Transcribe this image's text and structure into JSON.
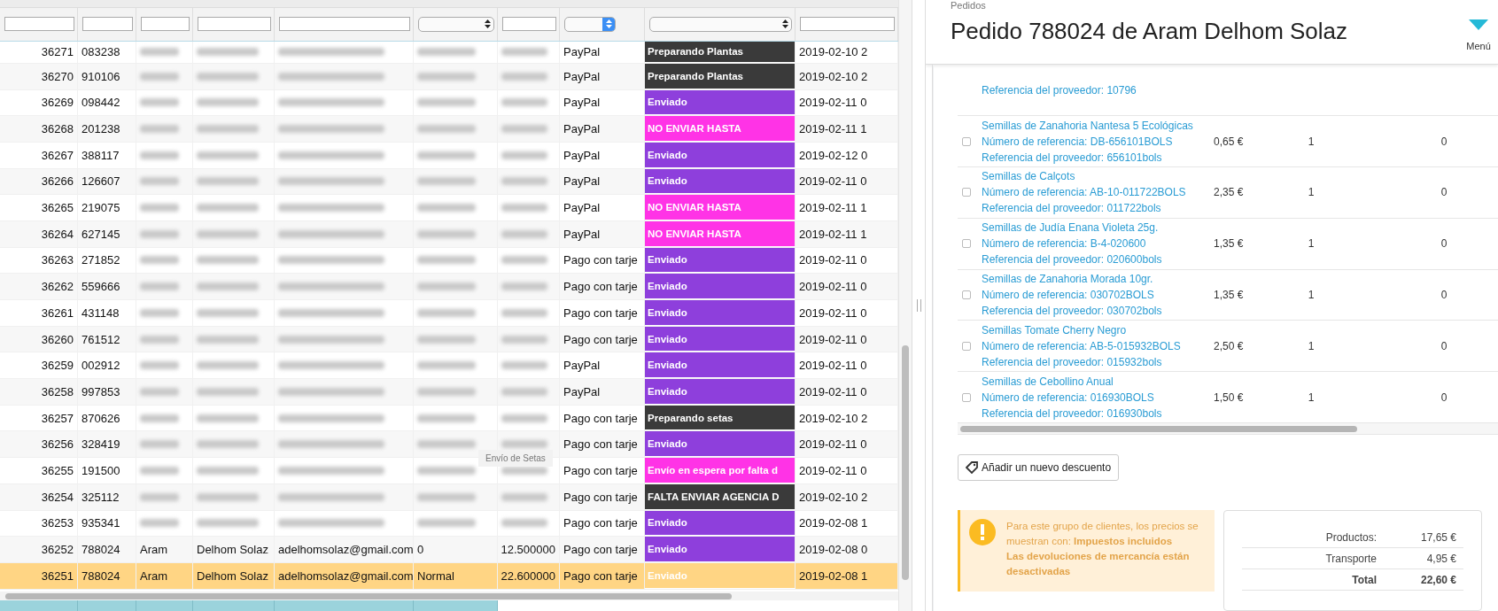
{
  "orders_table": {
    "filters": [
      {
        "kind": "text"
      },
      {
        "kind": "text"
      },
      {
        "kind": "text"
      },
      {
        "kind": "text"
      },
      {
        "kind": "text"
      },
      {
        "kind": "select",
        "highlighted": false
      },
      {
        "kind": "text"
      },
      {
        "kind": "select",
        "highlighted": true
      },
      {
        "kind": "select",
        "highlighted": false
      },
      {
        "kind": "text"
      }
    ],
    "rows": [
      {
        "id": "36271",
        "ref": "083238",
        "redacted": true,
        "payment": "PayPal",
        "status": "Preparando Plantas",
        "color": "#3a3a3a",
        "date": "2019-02-10 2",
        "selected": false
      },
      {
        "id": "36270",
        "ref": "910106",
        "redacted": true,
        "payment": "PayPal",
        "status": "Preparando Plantas",
        "color": "#3a3a3a",
        "date": "2019-02-10 2",
        "selected": false
      },
      {
        "id": "36269",
        "ref": "098442",
        "redacted": true,
        "payment": "PayPal",
        "status": "Enviado",
        "color": "#8e3fdc",
        "date": "2019-02-11 0",
        "selected": false
      },
      {
        "id": "36268",
        "ref": "201238",
        "redacted": true,
        "payment": "PayPal",
        "status": "NO ENVIAR HASTA",
        "color": "#ff33e6",
        "date": "2019-02-11 1",
        "selected": false
      },
      {
        "id": "36267",
        "ref": "388117",
        "redacted": true,
        "payment": "PayPal",
        "status": "Enviado",
        "color": "#8e3fdc",
        "date": "2019-02-12 0",
        "selected": false
      },
      {
        "id": "36266",
        "ref": "126607",
        "redacted": true,
        "payment": "PayPal",
        "status": "Enviado",
        "color": "#8e3fdc",
        "date": "2019-02-11 0",
        "selected": false
      },
      {
        "id": "36265",
        "ref": "219075",
        "redacted": true,
        "payment": "PayPal",
        "status": "NO ENVIAR HASTA",
        "color": "#ff33e6",
        "date": "2019-02-11 1",
        "selected": false
      },
      {
        "id": "36264",
        "ref": "627145",
        "redacted": true,
        "payment": "PayPal",
        "status": "NO ENVIAR HASTA",
        "color": "#ff33e6",
        "date": "2019-02-11 1",
        "selected": false
      },
      {
        "id": "36263",
        "ref": "271852",
        "redacted": true,
        "payment": "Pago con tarje",
        "status": "Enviado",
        "color": "#8e3fdc",
        "date": "2019-02-11 0",
        "selected": false
      },
      {
        "id": "36262",
        "ref": "559666",
        "redacted": true,
        "payment": "Pago con tarje",
        "status": "Enviado",
        "color": "#8e3fdc",
        "date": "2019-02-11 0",
        "selected": false
      },
      {
        "id": "36261",
        "ref": "431148",
        "redacted": true,
        "payment": "Pago con tarje",
        "status": "Enviado",
        "color": "#8e3fdc",
        "date": "2019-02-11 0",
        "selected": false
      },
      {
        "id": "36260",
        "ref": "761512",
        "redacted": true,
        "payment": "Pago con tarje",
        "status": "Enviado",
        "color": "#8e3fdc",
        "date": "2019-02-11 0",
        "selected": false
      },
      {
        "id": "36259",
        "ref": "002912",
        "redacted": true,
        "payment": "PayPal",
        "status": "Enviado",
        "color": "#8e3fdc",
        "date": "2019-02-11 0",
        "selected": false
      },
      {
        "id": "36258",
        "ref": "997853",
        "redacted": true,
        "payment": "PayPal",
        "status": "Enviado",
        "color": "#8e3fdc",
        "date": "2019-02-11 0",
        "selected": false
      },
      {
        "id": "36257",
        "ref": "870626",
        "redacted": true,
        "payment": "Pago con tarje",
        "status": "Preparando setas",
        "color": "#3a3a3a",
        "date": "2019-02-10 2",
        "selected": false
      },
      {
        "id": "36256",
        "ref": "328419",
        "redacted": true,
        "payment": "Pago con tarje",
        "status": "Enviado",
        "color": "#8e3fdc",
        "date": "2019-02-11 0",
        "selected": false
      },
      {
        "id": "36255",
        "ref": "191500",
        "redacted": true,
        "payment": "Pago con tarje",
        "status": "Envío en espera por falta d",
        "color": "#ff33e6",
        "date": "2019-02-11 0",
        "selected": false
      },
      {
        "id": "36254",
        "ref": "325112",
        "redacted": true,
        "payment": "Pago con tarje",
        "status": "FALTA ENVIAR AGENCIA D",
        "color": "#3a3a3a",
        "date": "2019-02-10 2",
        "selected": false
      },
      {
        "id": "36253",
        "ref": "935341",
        "redacted": true,
        "payment": "Pago con tarje",
        "status": "Enviado",
        "color": "#8e3fdc",
        "date": "2019-02-08 1",
        "selected": false
      },
      {
        "id": "36252",
        "ref": "788024",
        "redacted": false,
        "first_name": "Aram",
        "last_name": "Delhom Solaz",
        "email": "adelhomsolaz@gmail.com",
        "carrier": "0",
        "total": "12.500000",
        "payment": "Pago con tarje",
        "status": "Enviado",
        "color": "#8e3fdc",
        "date": "2019-02-08 0",
        "selected": false
      },
      {
        "id": "36251",
        "ref": "788024",
        "redacted": false,
        "first_name": "Aram",
        "last_name": "Delhom Solaz",
        "email": "adelhomsolaz@gmail.com",
        "carrier": "Normal",
        "total": "22.600000",
        "payment": "Pago con tarje",
        "status": "Enviado",
        "date": "2019-02-08 1",
        "selected": true
      }
    ],
    "tooltip": "Envío de Setas"
  },
  "order_panel": {
    "breadcrumb": "Pedidos",
    "title": "Pedido 788024 de Aram Delhom Solaz",
    "menu_label": "Menú",
    "products": [
      {
        "supplier_reference": "Referencia del proveedor: 10796"
      },
      {
        "name": "Semillas de Zanahoria Nantesa 5 Ecológicas",
        "reference": "Número de referencia: DB-656101BOLS",
        "supplier_reference": "Referencia del proveedor: 656101bols",
        "checked": false,
        "price": "0,65 €",
        "quantity": "1",
        "refunded": "0"
      },
      {
        "name": "Semillas de Calçots",
        "reference": "Número de referencia: AB-10-011722BOLS",
        "supplier_reference": "Referencia del proveedor: 011722bols",
        "checked": false,
        "price": "2,35 €",
        "quantity": "1",
        "refunded": "0"
      },
      {
        "name": "Semillas de Judía Enana Violeta 25g.",
        "reference": "Número de referencia: B-4-020600",
        "supplier_reference": "Referencia del proveedor: 020600bols",
        "checked": false,
        "price": "1,35 €",
        "quantity": "1",
        "refunded": "0"
      },
      {
        "name": "Semillas de Zanahoria Morada 10gr.",
        "reference": "Número de referencia: 030702BOLS",
        "supplier_reference": "Referencia del proveedor: 030702bols",
        "checked": false,
        "price": "1,35 €",
        "quantity": "1",
        "refunded": "0"
      },
      {
        "name": "Semillas Tomate Cherry Negro",
        "reference": "Número de referencia: AB-5-015932BOLS",
        "supplier_reference": "Referencia del proveedor: 015932bols",
        "checked": false,
        "price": "2,50 €",
        "quantity": "1",
        "refunded": "0"
      },
      {
        "name": "Semillas de Cebollino Anual",
        "reference": "Número de referencia: 016930BOLS",
        "supplier_reference": "Referencia del proveedor: 016930bols",
        "checked": false,
        "price": "1,50 €",
        "quantity": "1",
        "refunded": "0"
      }
    ],
    "discount_button": "Añadir un nuevo descuento",
    "alert": {
      "message": "Para este grupo de clientes, los precios se muestran con: **Impuestos incluidos**",
      "note": "Las devoluciones de mercancía están desactivadas"
    },
    "totals": [
      {
        "kind": "line",
        "label": "Productos:",
        "value": "17,65 €"
      },
      {
        "kind": "line",
        "label": "Transporte",
        "value": "4,95 €"
      },
      {
        "kind": "total",
        "label": "Total",
        "value": "22,60 €"
      }
    ]
  }
}
